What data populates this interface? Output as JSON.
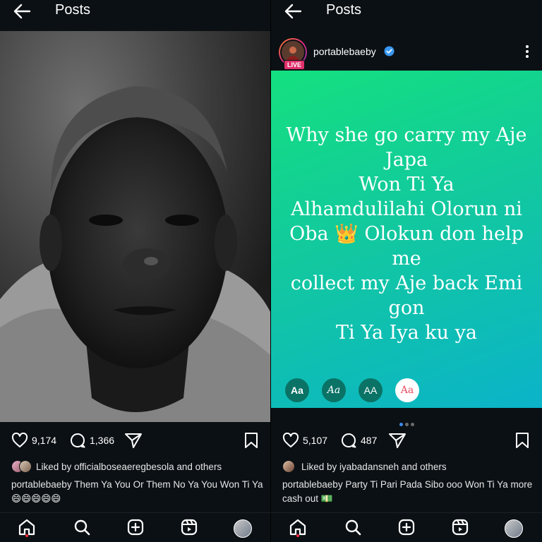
{
  "left_post": {
    "header_title": "Posts",
    "likes": "9,174",
    "comments": "1,366",
    "liked_by_text": "Liked by officialboseaeregbesola and others",
    "caption": "portablebaeby Them Ya You Or Them No Ya You Won Ti Ya 😄😄😄😄😄"
  },
  "right_post": {
    "header_title": "Posts",
    "username": "portablebaeby",
    "live_badge": "LIVE",
    "story_text_lines": [
      "Why she go carry my Aje",
      "Japa",
      "Won Ti Ya",
      "Alhamdulilahi Olorun ni",
      "Oba 👑 Olokun don help me",
      "collect my Aje back Emi gon",
      "Ti Ya Iya ku ya"
    ],
    "font_options": [
      "Aa",
      "Aa",
      "AA",
      "Aa"
    ],
    "likes": "5,107",
    "comments": "487",
    "liked_by_text": "Liked by iyabadansneh and others",
    "caption": "portablebaeby Party Ti Pari Pada Sibo  ooo Won Ti Ya more cash out 💵"
  },
  "colors": {
    "background": "#0b1014",
    "live_badge": "#e1306c",
    "verified": "#3897f0",
    "gradient_start": "#14e07f",
    "gradient_end": "#0bb3c9",
    "active_dot": "#3b8df1"
  },
  "icons": [
    "back-arrow-icon",
    "heart-icon",
    "comment-icon",
    "share-icon",
    "bookmark-icon",
    "mute-icon",
    "verified-icon",
    "more-icon",
    "home-icon",
    "search-icon",
    "create-icon",
    "reels-icon"
  ]
}
